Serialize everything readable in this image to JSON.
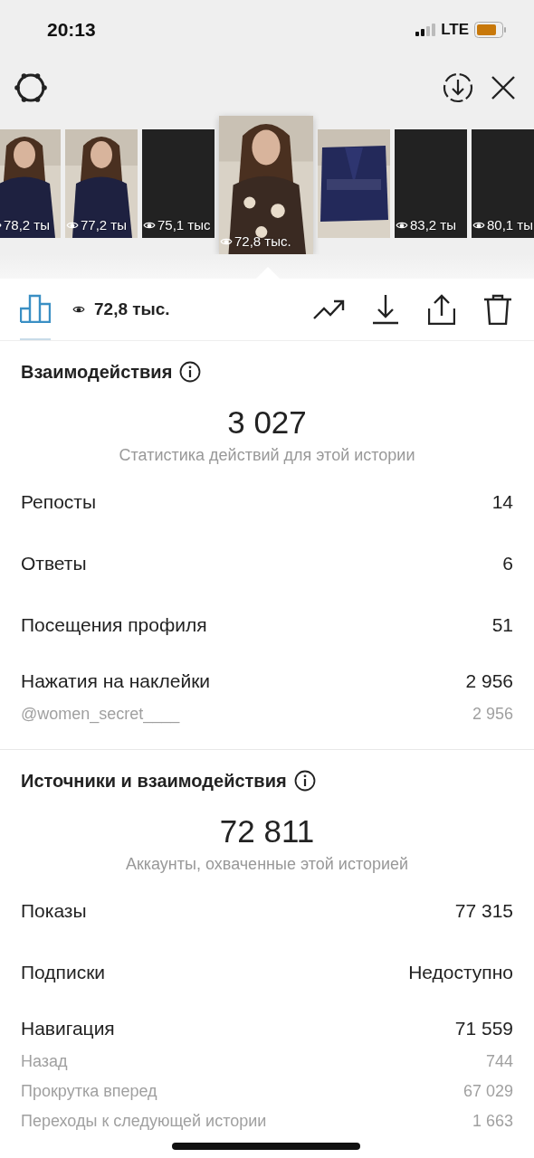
{
  "status_bar": {
    "time": "20:13",
    "network": "LTE"
  },
  "stories": [
    {
      "kind": "picture",
      "views": "78,2 ты",
      "selected": false
    },
    {
      "kind": "picture",
      "views": "77,2 ты",
      "selected": false
    },
    {
      "kind": "dark",
      "views": "75,1 тыс",
      "selected": false
    },
    {
      "kind": "picture",
      "views": "72,8 тыс.",
      "selected": true
    },
    {
      "kind": "picture",
      "selected": false
    },
    {
      "kind": "dark",
      "views": "83,2 ты",
      "selected": false
    },
    {
      "kind": "dark",
      "views": "80,1 ты",
      "selected": false
    }
  ],
  "toolbar": {
    "tab": {
      "selected": true
    },
    "views": "72,8 тыс."
  },
  "sections": [
    {
      "title": "Взаимодействия",
      "total": "3 027",
      "caption": "Статистика действий для этой истории",
      "rows": [
        {
          "kind": "main",
          "label": "Репосты",
          "value": "14"
        },
        {
          "kind": "main",
          "label": "Ответы",
          "value": "6"
        },
        {
          "kind": "main",
          "label": "Посещения профиля",
          "value": "51"
        },
        {
          "kind": "main",
          "label": "Нажатия на наклейки",
          "value": "2 956"
        },
        {
          "kind": "sub",
          "label": "@women_secret____",
          "value": "2 956"
        }
      ]
    },
    {
      "title": "Источники и взаимодействия",
      "total": "72 811",
      "caption": "Аккаунты, охваченные этой историей",
      "rows": [
        {
          "kind": "main",
          "label": "Показы",
          "value": "77 315"
        },
        {
          "kind": "main",
          "label": "Подписки",
          "value": "Недоступно"
        },
        {
          "kind": "main",
          "label": "Навигация",
          "value": "71 559"
        },
        {
          "kind": "sub",
          "label": "Назад",
          "value": "744"
        },
        {
          "kind": "sub",
          "label": "Прокрутка вперед",
          "value": "67 029"
        },
        {
          "kind": "sub",
          "label": "Переходы к следующей истории",
          "value": "1 663"
        }
      ]
    }
  ]
}
